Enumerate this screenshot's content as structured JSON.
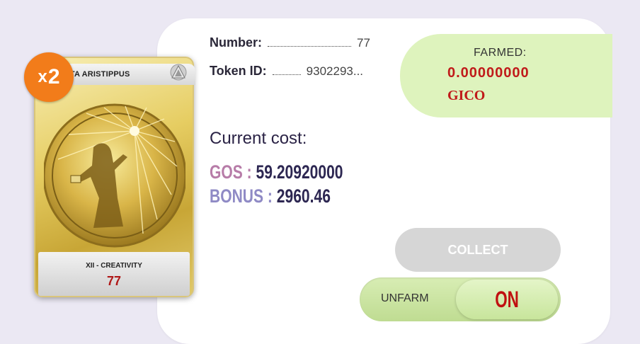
{
  "card": {
    "title": "META ARISTIPPUS",
    "multiplier_symbol": "x",
    "multiplier_value": "2",
    "subtitle": "XII - CREATIVITY",
    "number": "77",
    "logo_icon": "triangle-logo-icon"
  },
  "info": {
    "number_label": "Number:",
    "number_value": "77",
    "token_label": "Token ID:",
    "token_value": "9302293..."
  },
  "cost": {
    "title": "Current cost:",
    "gos_label": "GOS :",
    "gos_value": "59.20920000",
    "bonus_label": "BONUS :",
    "bonus_value": "2960.46"
  },
  "farmed": {
    "label": "FARMED:",
    "value": "0.00000000",
    "currency": "GICO"
  },
  "actions": {
    "collect_label": "COLLECT",
    "unfarm_label": "UNFARM",
    "toggle_state": "ON"
  },
  "colors": {
    "accent_green": "#def3bd",
    "value_red": "#c01a1a",
    "badge_orange": "#f27c1a",
    "gos_pink": "#b77ca8",
    "bonus_purple": "#8f8ac5"
  }
}
